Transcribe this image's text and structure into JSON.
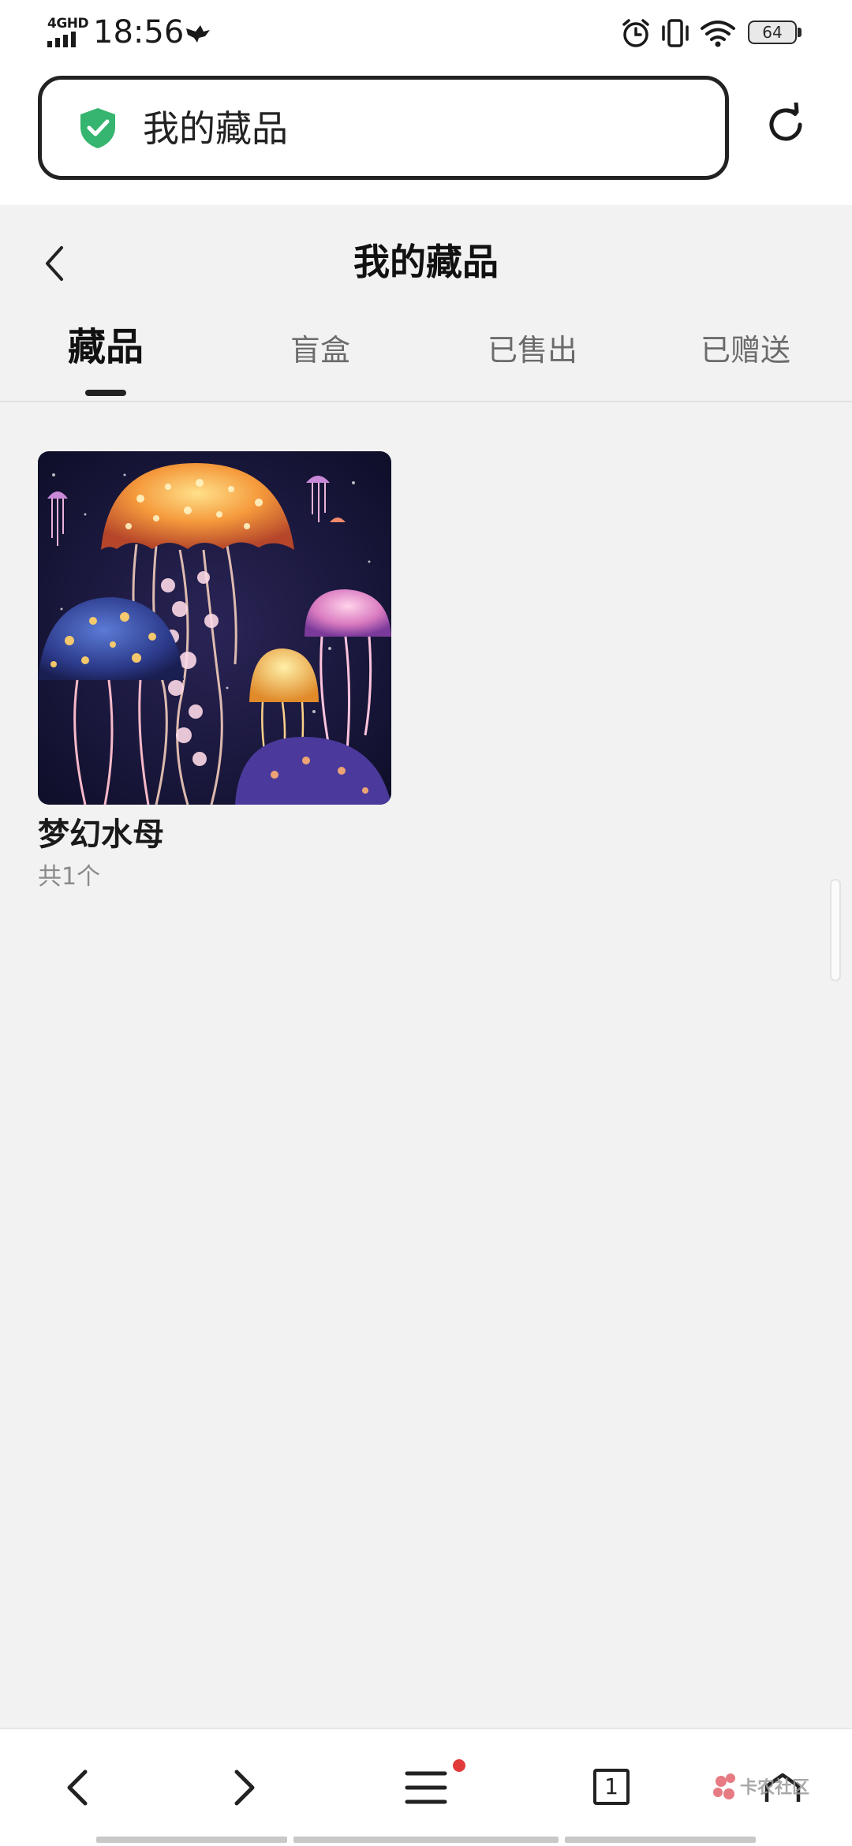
{
  "status_bar": {
    "network": "4GHD",
    "time": "18:56",
    "battery": "64"
  },
  "address_bar": {
    "title": "我的藏品"
  },
  "page": {
    "title": "我的藏品",
    "tabs": [
      {
        "label": "藏品",
        "active": true
      },
      {
        "label": "盲盒",
        "active": false
      },
      {
        "label": "已售出",
        "active": false
      },
      {
        "label": "已赠送",
        "active": false
      }
    ]
  },
  "items": [
    {
      "title": "梦幻水母",
      "count": "共1个"
    }
  ],
  "bottom_nav": {
    "tab_count": "1",
    "watermark": "卡农社区"
  },
  "colors": {
    "shield": "#35b56f",
    "notification_dot": "#e23a3a",
    "page_bg": "#f2f2f3"
  }
}
